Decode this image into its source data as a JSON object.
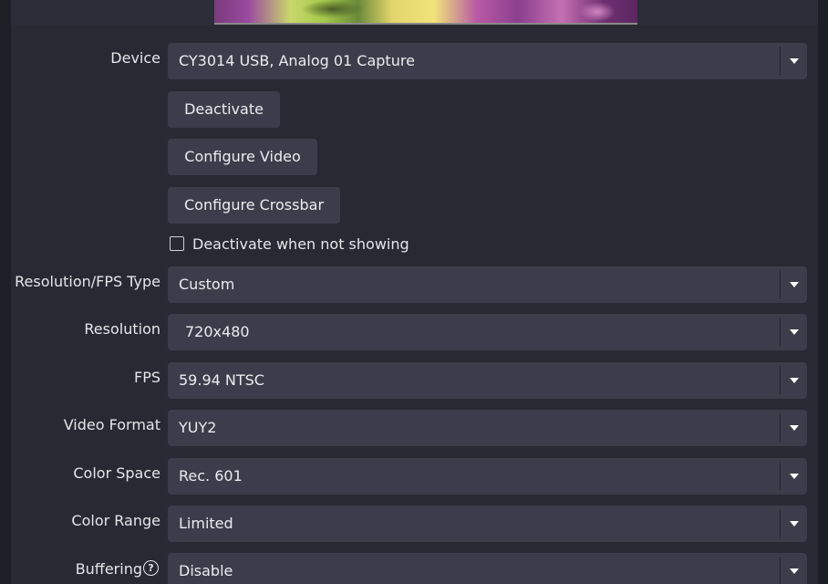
{
  "preview": {
    "frame_icon": "video-preview-frame"
  },
  "device": {
    "label": "Device",
    "value": "CY3014 USB, Analog 01 Capture"
  },
  "buttons": {
    "deactivate": "Deactivate",
    "configure_video": "Configure Video",
    "configure_crossbar": "Configure Crossbar"
  },
  "deactivate_when_not_showing": {
    "label": "Deactivate when not showing",
    "checked": false
  },
  "resolution_fps_type": {
    "label": "Resolution/FPS Type",
    "value": "Custom"
  },
  "resolution": {
    "label": "Resolution",
    "value": "720x480"
  },
  "fps": {
    "label": "FPS",
    "value": "59.94 NTSC"
  },
  "video_format": {
    "label": "Video Format",
    "value": "YUY2"
  },
  "color_space": {
    "label": "Color Space",
    "value": "Rec. 601"
  },
  "color_range": {
    "label": "Color Range",
    "value": "Limited"
  },
  "buffering": {
    "label": "Buffering",
    "help_glyph": "?",
    "value": "Disable"
  },
  "colors": {
    "background": "#1d1f26",
    "panel": "#272a33",
    "control": "#3b3e4a",
    "text": "#e6e6ea"
  }
}
